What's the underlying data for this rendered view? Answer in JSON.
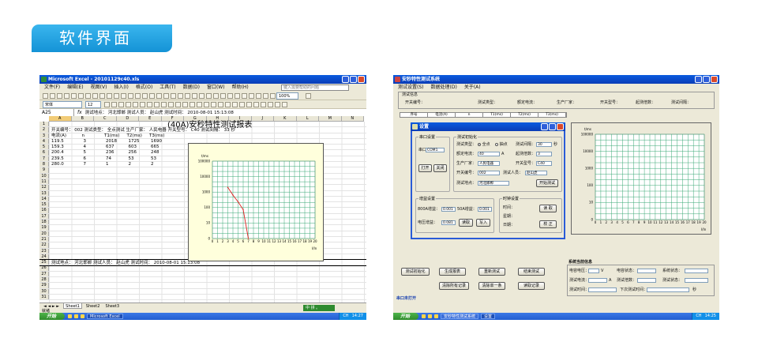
{
  "banner": {
    "title": "软件界面"
  },
  "excel": {
    "window_title": "Microsoft Excel - 20101129c40.xls",
    "menu": [
      "文件(F)",
      "编辑(E)",
      "视图(V)",
      "插入(I)",
      "格式(O)",
      "工具(T)",
      "数据(D)",
      "窗口(W)",
      "帮助(H)"
    ],
    "help_placeholder": "键入需要帮助的问题",
    "font_name": "宋体",
    "font_size": "12",
    "zoom": "100%",
    "name_box": "A25",
    "fx_label": "fx",
    "formula": "测试地点： 河北邯郸       测试人员： 赵山虎                      测试时间： 2010-08-01 15:13:08",
    "columns": [
      "A",
      "B",
      "C",
      "D",
      "E",
      "F",
      "G",
      "H",
      "I",
      "J",
      "K",
      "L",
      "M",
      "N"
    ],
    "report_title": "(40A)安秒特性测试报表",
    "row2": "开关编号： 002   测试类型： 全点测试   生产厂家： 人民电器   开关型号： C40   测试间隔： 33 秒",
    "headers": [
      "电流(A)",
      "n",
      "T1(ms)",
      "T2(ms)",
      "T3(ms)"
    ],
    "data_rows": [
      [
        "119.5",
        "3",
        "2018",
        "1725",
        "1690"
      ],
      [
        "159.3",
        "4",
        "637",
        "603",
        "665"
      ],
      [
        "200.4",
        "5",
        "236",
        "256",
        "248"
      ],
      [
        "239.5",
        "6",
        "74",
        "53",
        "53"
      ],
      [
        "280.0",
        "7",
        "1",
        "2",
        "2"
      ]
    ],
    "row25": "测试地点： 河北邯郸              测试人员： 赵山虎                  测试时间： 2010-08-01 15:13:08",
    "chart_ylabel": "t/ms",
    "chart_xlabel": "I/In",
    "sheet_tabs": [
      "Sheet1",
      "Sheet2",
      "Sheet3"
    ],
    "status_text": "就绪",
    "start_label": "开始",
    "task_label": "Microsoft Excel",
    "clock": "14:27",
    "tray_lang": "CH",
    "ime_label": "中 拼 。"
  },
  "app": {
    "window_title": "安秒特性测试系统",
    "menu": [
      "测试设置(S)",
      "数据处理(D)",
      "关于(A)"
    ],
    "info_section": "测试信息",
    "info_labels": [
      "开关编号：",
      "测试类型：",
      "额定电流：",
      "生产厂家：",
      "开关型号：",
      "起测倍数：",
      "测试间隔："
    ],
    "table_headers": [
      "序号",
      "电流(A)",
      "n",
      "T1(ms)",
      "T2(ms)",
      "T3(ms)"
    ],
    "dialog": {
      "title": "设置",
      "serial_group": "串口设置",
      "port_label": "串口",
      "port_value": "COM1",
      "open_btn": "打开",
      "close_btn": "关闭",
      "init_group": "测试初始化",
      "type_label": "测试类型：",
      "opt_all": "全点",
      "opt_single": "抽点",
      "interval_label": "测试间隔：",
      "interval_value": "30",
      "sec": "秒",
      "rated_label": "额定电流：",
      "rated_value": "40",
      "amp": "A",
      "start_mult_label": "起测倍数：",
      "start_mult_value": "3",
      "maker_label": "生产厂家：",
      "maker_value": "人民电器",
      "model_label": "开关型号：",
      "model_value": "C40",
      "num_label": "开关编号：",
      "num_value": "002",
      "person_label": "测试人员：",
      "person_value": "赵山虎",
      "place_label": "测试地点：",
      "place_value": "河北邯郸",
      "start_test_btn": "开始测试",
      "gain_group": "增益设置",
      "gain800_label": "800A增益：",
      "gain800_value": "0.001",
      "gain50_label": "50A增益：",
      "gain50_value": "0.001",
      "volt_label": "电压增益：",
      "volt_value": "0.081",
      "read_btn": "读取",
      "write_btn": "写入",
      "clock_group": "时钟设置",
      "time_label": "时间：",
      "week_label": "星期：",
      "date_label": "日期：",
      "read_clock_btn": "读 取",
      "calib_btn": "校 正"
    },
    "chart_ylabel": "t/ms",
    "chart_xlabel": "I/In",
    "buttons": [
      "测试初始化",
      "生成报表",
      "重新测试",
      "结束测试",
      "清除所有记录",
      "清除单一条",
      "读取记录"
    ],
    "status_section": "系统当前信息",
    "status_labels": [
      "电容电压：",
      "电容状态：",
      "系统状态：",
      "测试电流：",
      "测试倍数：",
      "测试状态：",
      "测试时间：",
      "下次测试时间："
    ],
    "unit_v": "V",
    "unit_a": "A",
    "unit_s": "秒",
    "port_status": "串口未打开",
    "task1": "安秒特性测试系统",
    "task2": "设置",
    "clock": "14:25",
    "tray_lang": "CH"
  },
  "chart_data": {
    "type": "line",
    "x": [
      3,
      4,
      5,
      6,
      7
    ],
    "y": [
      2018,
      637,
      236,
      74,
      1
    ],
    "xlabel": "I/In",
    "ylabel": "t/ms",
    "xlim": [
      0,
      20
    ],
    "ylim": [
      0,
      100000
    ],
    "y_scale": "log",
    "y_ticks": [
      "100000",
      "10000",
      "1000",
      "100",
      "10",
      "0"
    ],
    "x_ticks": [
      "0",
      "1",
      "2",
      "3",
      "4",
      "5",
      "6",
      "7",
      "8",
      "9",
      "10",
      "11",
      "12",
      "13",
      "14",
      "15",
      "16",
      "17",
      "18",
      "19",
      "20"
    ],
    "grid": true
  }
}
